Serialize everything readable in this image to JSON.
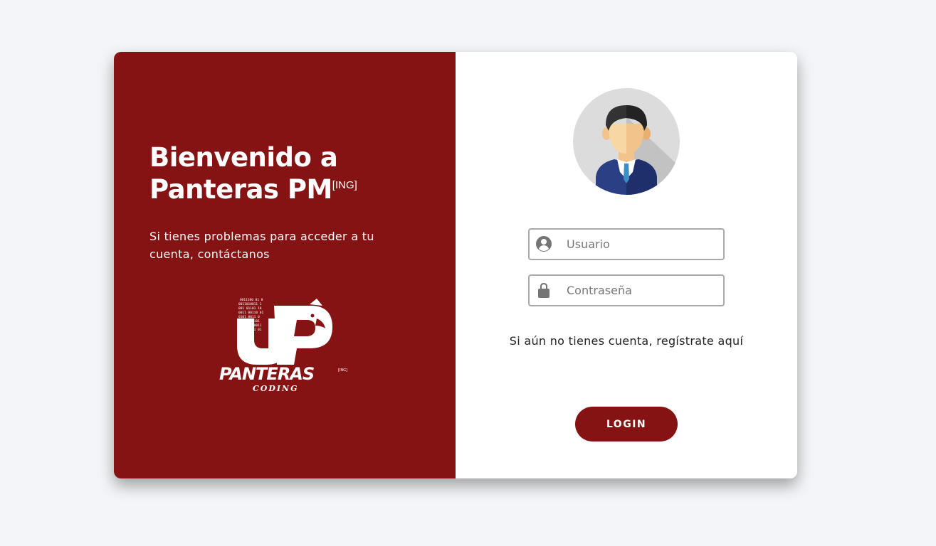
{
  "welcome": {
    "title_line1": "Bienvenido a",
    "title_line2": "Panteras PM",
    "title_sup": "[ING]",
    "help_text": "Si tienes problemas para acceder a tu cuenta, contáctanos"
  },
  "logo": {
    "brand": "PANTERAS",
    "sub": "CODING",
    "tag": "[ING]"
  },
  "form": {
    "username_placeholder": "Usuario",
    "password_placeholder": "Contraseña",
    "register_prefix": "Si aún no tienes cuenta, ",
    "register_link": "regístrate aquí",
    "login_label": "LOGIN"
  },
  "colors": {
    "brand_red": "#861313",
    "background": "#f4f5f8",
    "field_border": "#a9a9a9"
  },
  "icons": {
    "username": "user-circle-icon",
    "password": "lock-icon",
    "avatar": "user-avatar-icon"
  }
}
